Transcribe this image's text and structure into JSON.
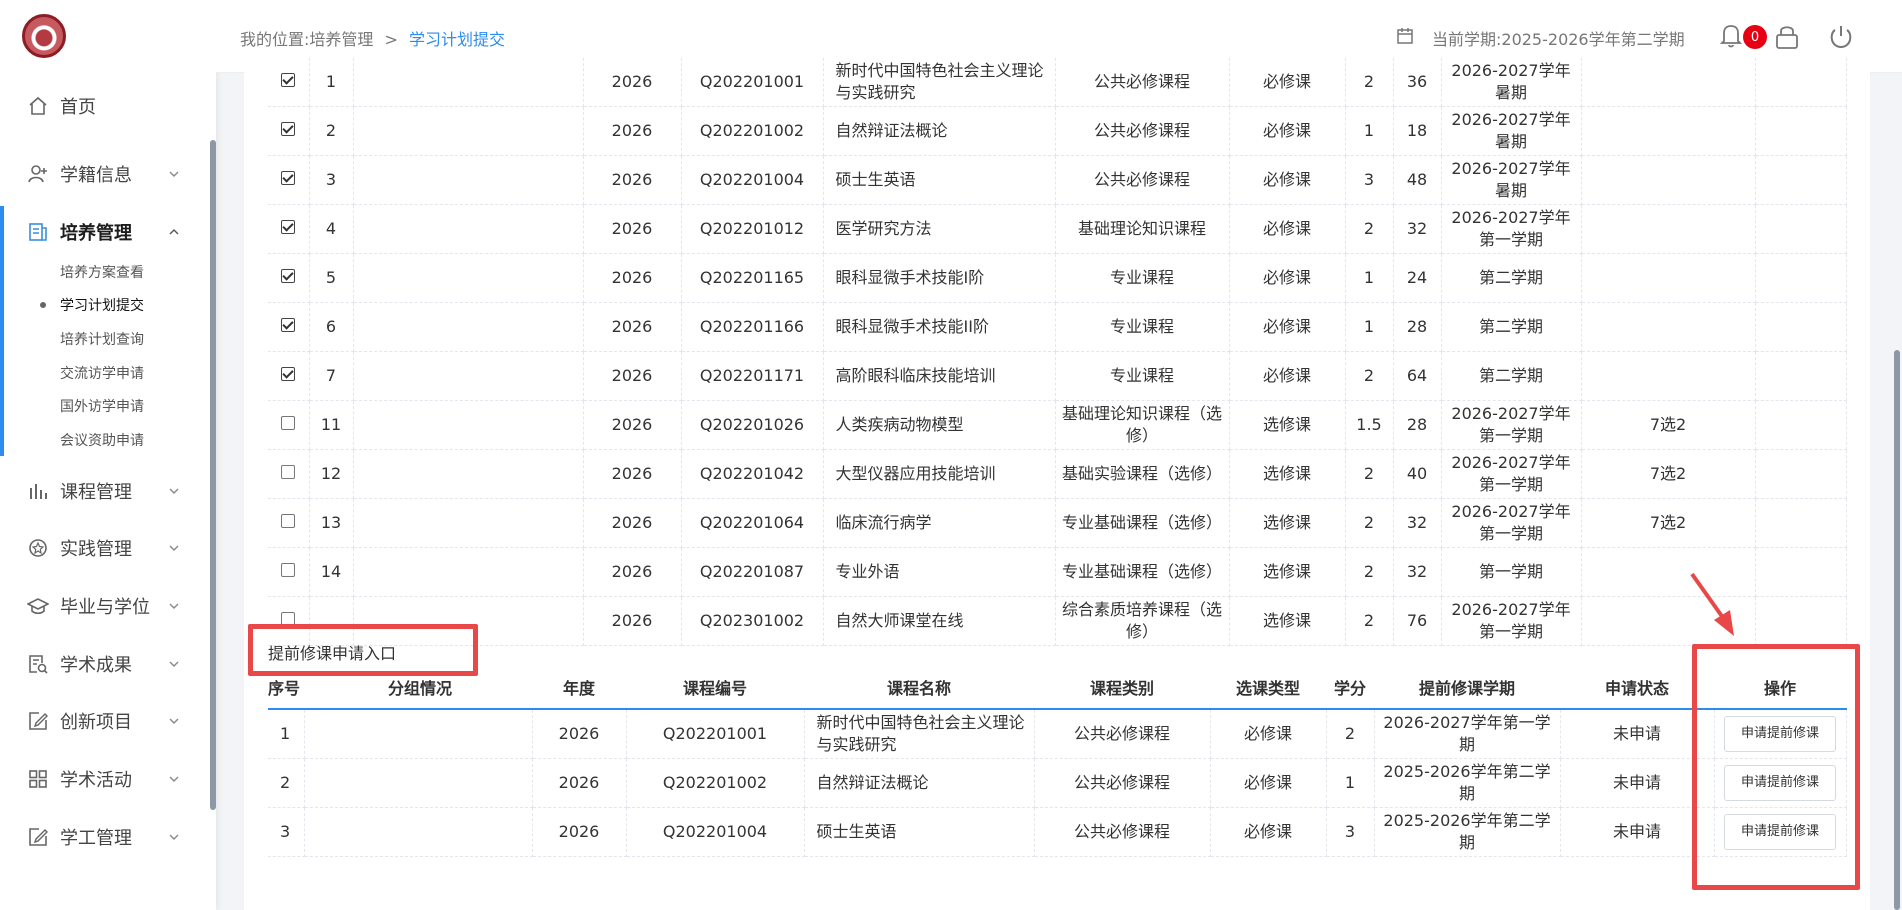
{
  "header": {
    "breadcrumb_prefix": "我的位置:培养管理",
    "breadcrumb_sep": ">",
    "breadcrumb_current": "学习计划提交",
    "semester": "当前学期:2025-2026学年第二学期",
    "notification_count": "0"
  },
  "sidebar": {
    "items": [
      {
        "label": "首页",
        "icon": "home-icon"
      },
      {
        "label": "学籍信息",
        "icon": "user-add-icon"
      },
      {
        "label": "培养管理",
        "icon": "document-icon"
      },
      {
        "label": "课程管理",
        "icon": "bar-chart-icon"
      },
      {
        "label": "实践管理",
        "icon": "star-badge-icon"
      },
      {
        "label": "毕业与学位",
        "icon": "graduation-cap-icon"
      },
      {
        "label": "学术成果",
        "icon": "search-document-icon"
      },
      {
        "label": "创新项目",
        "icon": "edit-icon"
      },
      {
        "label": "学术活动",
        "icon": "grid-icon"
      },
      {
        "label": "学工管理",
        "icon": "edit-icon"
      }
    ],
    "sub_items": [
      "培养方案查看",
      "学习计划提交",
      "培养计划查询",
      "交流访学申请",
      "国外访学申请",
      "会议资助申请"
    ]
  },
  "plan_rows": [
    {
      "checked": true,
      "no": "1",
      "group": "",
      "year": "2026",
      "code": "Q202201001",
      "name": "新时代中国特色社会主义理论与实践研究",
      "type": "公共必修课程",
      "sel": "必修课",
      "credit": "2",
      "hours": "36",
      "term": "2026-2027学年暑期",
      "note": ""
    },
    {
      "checked": true,
      "no": "2",
      "group": "",
      "year": "2026",
      "code": "Q202201002",
      "name": "自然辩证法概论",
      "type": "公共必修课程",
      "sel": "必修课",
      "credit": "1",
      "hours": "18",
      "term": "2026-2027学年暑期",
      "note": ""
    },
    {
      "checked": true,
      "no": "3",
      "group": "",
      "year": "2026",
      "code": "Q202201004",
      "name": "硕士生英语",
      "type": "公共必修课程",
      "sel": "必修课",
      "credit": "3",
      "hours": "48",
      "term": "2026-2027学年暑期",
      "note": ""
    },
    {
      "checked": true,
      "no": "4",
      "group": "",
      "year": "2026",
      "code": "Q202201012",
      "name": "医学研究方法",
      "type": "基础理论知识课程",
      "sel": "必修课",
      "credit": "2",
      "hours": "32",
      "term": "2026-2027学年第一学期",
      "note": ""
    },
    {
      "checked": true,
      "no": "5",
      "group": "",
      "year": "2026",
      "code": "Q202201165",
      "name": "眼科显微手术技能I阶",
      "type": "专业课程",
      "sel": "必修课",
      "credit": "1",
      "hours": "24",
      "term": "第二学期",
      "note": ""
    },
    {
      "checked": true,
      "no": "6",
      "group": "",
      "year": "2026",
      "code": "Q202201166",
      "name": "眼科显微手术技能II阶",
      "type": "专业课程",
      "sel": "必修课",
      "credit": "1",
      "hours": "28",
      "term": "第二学期",
      "note": ""
    },
    {
      "checked": true,
      "no": "7",
      "group": "",
      "year": "2026",
      "code": "Q202201171",
      "name": "高阶眼科临床技能培训",
      "type": "专业课程",
      "sel": "必修课",
      "credit": "2",
      "hours": "64",
      "term": "第二学期",
      "note": ""
    },
    {
      "checked": false,
      "no": "11",
      "group": "",
      "year": "2026",
      "code": "Q202201026",
      "name": "人类疾病动物模型",
      "type": "基础理论知识课程（选修）",
      "sel": "选修课",
      "credit": "1.5",
      "hours": "28",
      "term": "2026-2027学年第一学期",
      "note": "7选2"
    },
    {
      "checked": false,
      "no": "12",
      "group": "",
      "year": "2026",
      "code": "Q202201042",
      "name": "大型仪器应用技能培训",
      "type": "基础实验课程（选修）",
      "sel": "选修课",
      "credit": "2",
      "hours": "40",
      "term": "2026-2027学年第一学期",
      "note": "7选2"
    },
    {
      "checked": false,
      "no": "13",
      "group": "",
      "year": "2026",
      "code": "Q202201064",
      "name": "临床流行病学",
      "type": "专业基础课程（选修）",
      "sel": "选修课",
      "credit": "2",
      "hours": "32",
      "term": "2026-2027学年第一学期",
      "note": "7选2"
    },
    {
      "checked": false,
      "no": "14",
      "group": "",
      "year": "2026",
      "code": "Q202201087",
      "name": "专业外语",
      "type": "专业基础课程（选修）",
      "sel": "选修课",
      "credit": "2",
      "hours": "32",
      "term": "第一学期",
      "note": ""
    },
    {
      "checked": false,
      "no": "",
      "group": "",
      "year": "2026",
      "code": "Q202301002",
      "name": "自然大师课堂在线",
      "type": "综合素质培养课程（选修）",
      "sel": "选修课",
      "credit": "2",
      "hours": "76",
      "term": "2026-2027学年第一学期",
      "note": ""
    }
  ],
  "advance": {
    "entry_label": "提前修课申请入口",
    "headers": [
      "序号",
      "分组情况",
      "年度",
      "课程编号",
      "课程名称",
      "课程类别",
      "选课类型",
      "学分",
      "提前修课学期",
      "申请状态",
      "操作"
    ],
    "rows": [
      {
        "no": "1",
        "group": "",
        "year": "2026",
        "code": "Q202201001",
        "name": "新时代中国特色社会主义理论与实践研究",
        "type": "公共必修课程",
        "sel": "必修课",
        "credit": "2",
        "term": "2026-2027学年第一学期",
        "status": "未申请",
        "action": "申请提前修课"
      },
      {
        "no": "2",
        "group": "",
        "year": "2026",
        "code": "Q202201002",
        "name": "自然辩证法概论",
        "type": "公共必修课程",
        "sel": "必修课",
        "credit": "1",
        "term": "2025-2026学年第二学期",
        "status": "未申请",
        "action": "申请提前修课"
      },
      {
        "no": "3",
        "group": "",
        "year": "2026",
        "code": "Q202201004",
        "name": "硕士生英语",
        "type": "公共必修课程",
        "sel": "必修课",
        "credit": "3",
        "term": "2025-2026学年第二学期",
        "status": "未申请",
        "action": "申请提前修课"
      }
    ]
  },
  "colors": {
    "accent": "#2d8cf0",
    "highlight": "#e84848",
    "badge": "#e60012"
  }
}
